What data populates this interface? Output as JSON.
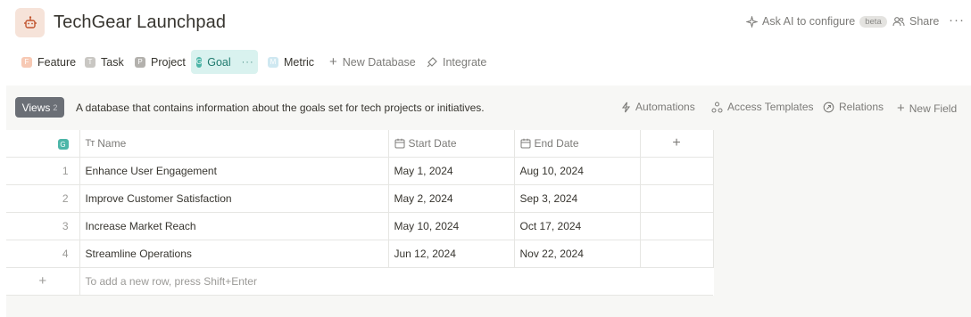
{
  "header": {
    "title": "TechGear Launchpad",
    "icon": "robot-icon",
    "ask_ai_label": "Ask AI to configure",
    "beta_label": "beta",
    "share_label": "Share",
    "more_label": "···"
  },
  "tabs": [
    {
      "label": "Feature",
      "badge": "F",
      "color": "#f4b59a",
      "active": false
    },
    {
      "label": "Task",
      "badge": "T",
      "color": "#b8b6b2",
      "active": false
    },
    {
      "label": "Project",
      "badge": "P",
      "color": "#a8a6a2",
      "active": false
    },
    {
      "label": "Goal",
      "badge": "G",
      "color": "#4db6a8",
      "active": true,
      "more": "···"
    },
    {
      "label": "Metric",
      "badge": "M",
      "color": "#bfe3ef",
      "active": false
    },
    {
      "label": "New Database",
      "icon": "plus-icon",
      "active": false
    },
    {
      "label": "Integrate",
      "icon": "plug-icon",
      "active": false
    }
  ],
  "toolbar": {
    "views_label": "Views",
    "views_count": "2",
    "description": "A database that contains information about the goals set for tech projects or initiatives.",
    "automations_label": "Automations",
    "access_templates_label": "Access Templates",
    "relations_label": "Relations",
    "new_field_label": "New Field"
  },
  "table": {
    "index_badge": "G",
    "columns": {
      "name": "Name",
      "start": "Start Date",
      "end": "End Date",
      "add": "+"
    },
    "rows": [
      {
        "index": "1",
        "name": "Enhance User Engagement",
        "start": "May 1, 2024",
        "end": "Aug 10, 2024"
      },
      {
        "index": "2",
        "name": "Improve Customer Satisfaction",
        "start": "May 2, 2024",
        "end": "Sep 3, 2024"
      },
      {
        "index": "3",
        "name": "Increase Market Reach",
        "start": "May 10, 2024",
        "end": "Oct 17, 2024"
      },
      {
        "index": "4",
        "name": "Streamline Operations",
        "start": "Jun 12, 2024",
        "end": "Nov 22, 2024"
      }
    ],
    "add_row_hint": "To add a new row, press Shift+Enter"
  },
  "colors": {
    "accent": "#4db6a8",
    "active_tab_bg": "#d9f2ef",
    "views_button": "#6b6f76"
  }
}
